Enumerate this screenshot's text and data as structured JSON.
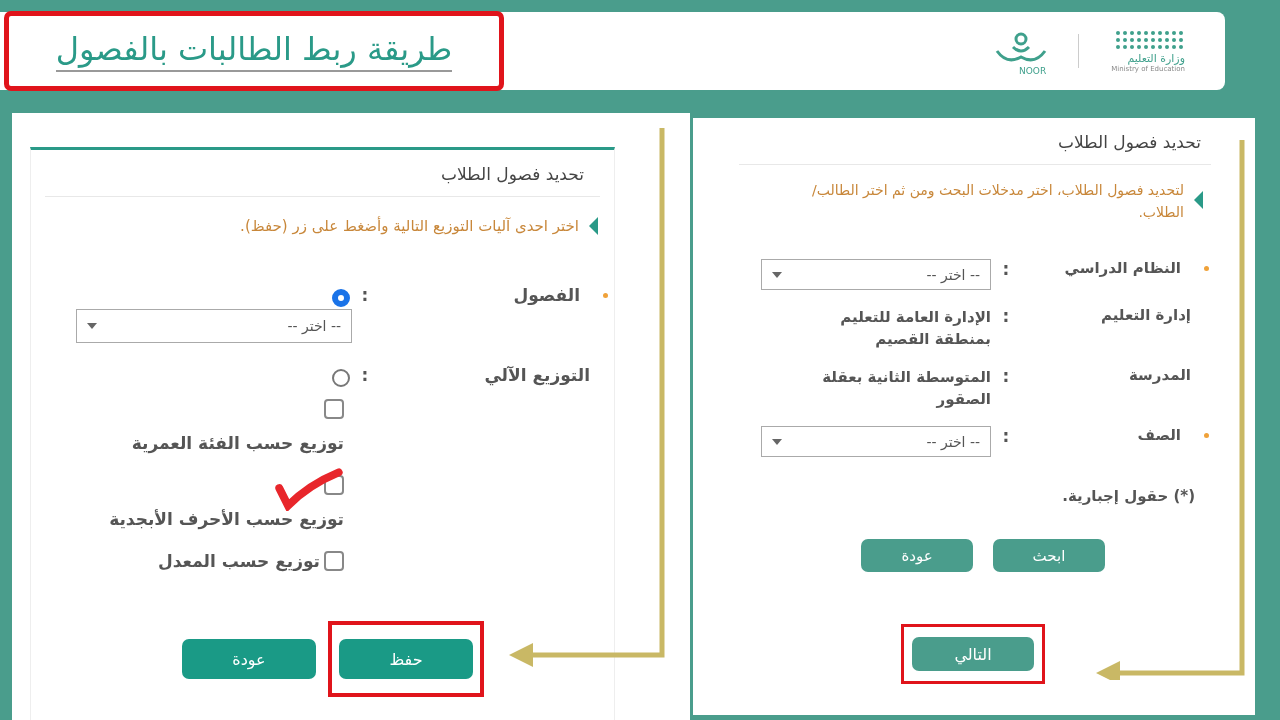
{
  "header": {
    "title": "طريقة ربط الطالبات بالفصول",
    "ministry_ar": "وزارة التعليم",
    "ministry_en": "Ministry of Education",
    "noor": "NOOR"
  },
  "left_panel": {
    "title": "تحديد فصول الطلاب",
    "instruction": "اختر احدى آليات التوزيع التالية وأضغط على زر (حفظ).",
    "separator": ":",
    "options": [
      {
        "label": "الفصول",
        "required": true,
        "selected": true,
        "placeholder": "-- اختر --"
      },
      {
        "label": "التوزيع الآلي",
        "required": false,
        "selected": false
      }
    ],
    "checkboxes": [
      {
        "kind": "stacked",
        "label": "توزيع حسب الفئة العمرية",
        "checked": false,
        "annotated": false
      },
      {
        "kind": "stacked",
        "label": "توزيع حسب الأحرف الأبجدية",
        "checked": false,
        "annotated": true
      },
      {
        "kind": "inline",
        "label": "توزيع حسب المعدل",
        "checked": false,
        "annotated": false
      }
    ],
    "buttons": [
      {
        "label": "حفظ",
        "highlighted": true
      },
      {
        "label": "عودة",
        "highlighted": false
      }
    ]
  },
  "right_panel": {
    "title": "تحديد فصول الطلاب",
    "instruction": "لتحديد فصول الطلاب، اختر مدخلات البحث ومن ثم اختر الطالب/ الطلاب.",
    "separator": ":",
    "fields": [
      {
        "kind": "select",
        "label": "النظام الدراسي",
        "required": true,
        "placeholder": "-- اختر --"
      },
      {
        "kind": "text",
        "label": "إدارة التعليم",
        "required": false,
        "value": "الإدارة العامة للتعليم بمنطقة القصيم"
      },
      {
        "kind": "text",
        "label": "المدرسة",
        "required": false,
        "value": "المتوسطة الثانية بعقلة الصقور"
      },
      {
        "kind": "select",
        "label": "الصف",
        "required": true,
        "placeholder": "-- اختر --"
      }
    ],
    "note": "(*) حقول إجبارية.",
    "buttons": [
      {
        "label": "ابحث",
        "highlighted": false
      },
      {
        "label": "عودة",
        "highlighted": false
      }
    ],
    "next_button": {
      "label": "التالي",
      "highlighted": true
    }
  }
}
